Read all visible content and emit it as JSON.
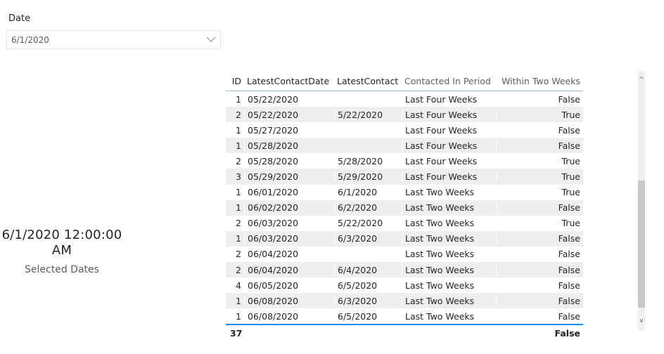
{
  "slicer": {
    "title": "Date",
    "value": "6/1/2020",
    "chevron_icon": "chevron-down-icon"
  },
  "card": {
    "value": "6/1/2020 12:00:00 AM",
    "label": "Selected Dates"
  },
  "table": {
    "columns": [
      "ID",
      "LatestContactDate",
      "LatestContact",
      "Contacted In Period",
      "Within Two Weeks"
    ],
    "rows": [
      [
        "1",
        "05/22/2020",
        "",
        "Last Four Weeks",
        "False"
      ],
      [
        "2",
        "05/22/2020",
        "5/22/2020",
        "Last Four Weeks",
        "True"
      ],
      [
        "1",
        "05/27/2020",
        "",
        "Last Four Weeks",
        "False"
      ],
      [
        "1",
        "05/28/2020",
        "",
        "Last Four Weeks",
        "False"
      ],
      [
        "2",
        "05/28/2020",
        "5/28/2020",
        "Last Four Weeks",
        "True"
      ],
      [
        "3",
        "05/29/2020",
        "5/29/2020",
        "Last Four Weeks",
        "True"
      ],
      [
        "1",
        "06/01/2020",
        "6/1/2020",
        "Last Two Weeks",
        "True"
      ],
      [
        "1",
        "06/02/2020",
        "6/2/2020",
        "Last Two Weeks",
        "False"
      ],
      [
        "2",
        "06/03/2020",
        "5/22/2020",
        "Last Two Weeks",
        "True"
      ],
      [
        "1",
        "06/03/2020",
        "6/3/2020",
        "Last Two Weeks",
        "False"
      ],
      [
        "2",
        "06/04/2020",
        "",
        "Last Two Weeks",
        "False"
      ],
      [
        "2",
        "06/04/2020",
        "6/4/2020",
        "Last Two Weeks",
        "False"
      ],
      [
        "4",
        "06/05/2020",
        "6/5/2020",
        "Last Two Weeks",
        "False"
      ],
      [
        "1",
        "06/08/2020",
        "6/3/2020",
        "Last Two Weeks",
        "False"
      ],
      [
        "1",
        "06/08/2020",
        "6/5/2020",
        "Last Two Weeks",
        "False"
      ]
    ],
    "total": [
      "37",
      "",
      "",
      "",
      "False"
    ]
  },
  "scrollbar": {
    "up_icon": "^",
    "down_icon": "v",
    "position_fraction": 0.42
  },
  "colors": {
    "accent": "#118dff",
    "header_underline": "#8fc1ea",
    "alt_row": "#eeeeee",
    "scroll_thumb": "#c8c8c8"
  }
}
